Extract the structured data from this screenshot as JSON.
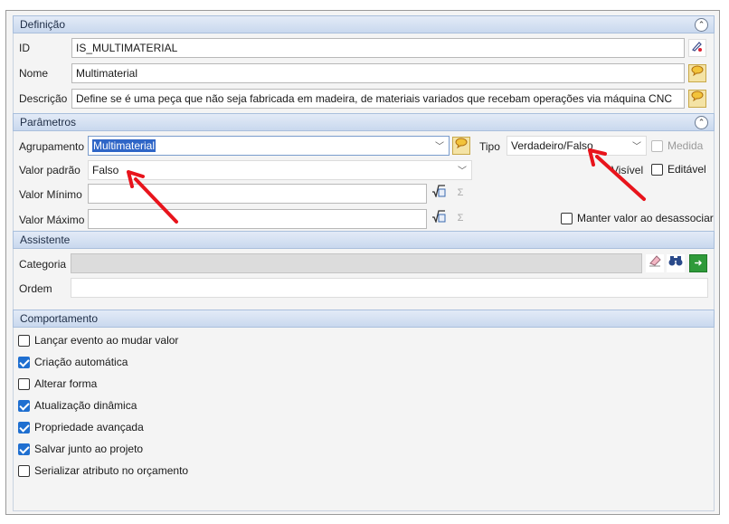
{
  "definicao": {
    "header": "Definição",
    "id_label": "ID",
    "id_value": "IS_MULTIMATERIAL",
    "nome_label": "Nome",
    "nome_value": "Multimaterial",
    "descricao_label": "Descrição",
    "descricao_value": "Define se é uma peça que não seja fabricada em madeira, de materiais variados que recebam operações via máquina CNC"
  },
  "parametros": {
    "header": "Parâmetros",
    "agrupamento_label": "Agrupamento",
    "agrupamento_value": "Multimaterial",
    "tipo_label": "Tipo",
    "tipo_value": "Verdadeiro/Falso",
    "medida_label": "Medida",
    "valor_padrao_label": "Valor padrão",
    "valor_padrao_value": "Falso",
    "visivel_label": "Visível",
    "editavel_label": "Editável",
    "valor_minimo_label": "Valor Mínimo",
    "valor_maximo_label": "Valor Máximo",
    "manter_label": "Manter valor ao desassociar"
  },
  "assistente": {
    "header": "Assistente",
    "categoria_label": "Categoria",
    "ordem_label": "Ordem"
  },
  "comportamento": {
    "header": "Comportamento",
    "options": [
      {
        "label": "Lançar evento ao mudar valor",
        "checked": false
      },
      {
        "label": "Criação automática",
        "checked": true
      },
      {
        "label": "Alterar forma",
        "checked": false
      },
      {
        "label": "Atualização dinâmica",
        "checked": true
      },
      {
        "label": "Propriedade avançada",
        "checked": true
      },
      {
        "label": "Salvar junto ao projeto",
        "checked": true
      },
      {
        "label": "Serializar atributo no orçamento",
        "checked": false
      }
    ]
  },
  "icons": {
    "collapse": "chevron-up-double-icon",
    "id_button": "edit-id-icon",
    "translate": "speech-bubble-icon",
    "formula": "formula-icon",
    "sum": "sigma-icon",
    "eraser": "eraser-icon",
    "search": "binoculars-icon",
    "go": "arrow-right-icon",
    "annotation": "red-arrow"
  },
  "colors": {
    "header_bg": "#c9d8ee",
    "checkbox_checked": "#1f6fd0",
    "selection": "#2f66c7",
    "annotation_arrow": "#e8141c"
  }
}
